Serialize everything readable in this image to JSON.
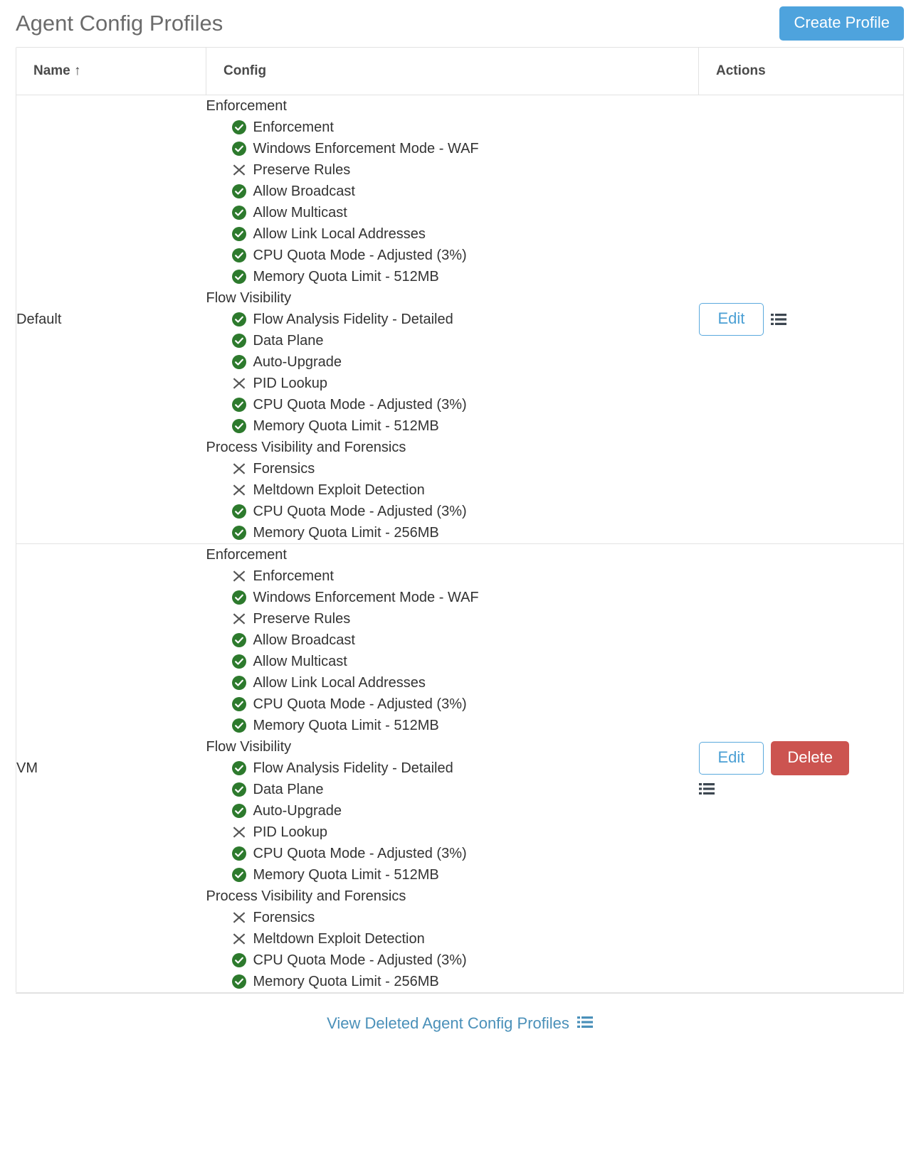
{
  "header": {
    "title": "Agent Config Profiles",
    "create_button": "Create Profile",
    "create_button_color": "#4ea3dd"
  },
  "table": {
    "columns": [
      {
        "label": "Name ↑",
        "key": "name"
      },
      {
        "label": "Config",
        "key": "config"
      },
      {
        "label": "Actions",
        "key": "actions"
      }
    ],
    "sort": {
      "column": "Name",
      "direction": "asc",
      "indicator": "↑"
    },
    "rows": [
      {
        "name": "Default",
        "config_groups": [
          {
            "title": "Enforcement",
            "items": [
              {
                "label": "Enforcement",
                "status": "enabled"
              },
              {
                "label": "Windows Enforcement Mode - WAF",
                "status": "enabled"
              },
              {
                "label": "Preserve Rules",
                "status": "disabled"
              },
              {
                "label": "Allow Broadcast",
                "status": "enabled"
              },
              {
                "label": "Allow Multicast",
                "status": "enabled"
              },
              {
                "label": "Allow Link Local Addresses",
                "status": "enabled"
              },
              {
                "label": "CPU Quota Mode - Adjusted (3%)",
                "status": "enabled"
              },
              {
                "label": "Memory Quota Limit - 512MB",
                "status": "enabled"
              }
            ]
          },
          {
            "title": "Flow Visibility",
            "items": [
              {
                "label": "Flow Analysis Fidelity - Detailed",
                "status": "enabled"
              },
              {
                "label": "Data Plane",
                "status": "enabled"
              },
              {
                "label": "Auto-Upgrade",
                "status": "enabled"
              },
              {
                "label": "PID Lookup",
                "status": "disabled"
              },
              {
                "label": "CPU Quota Mode - Adjusted (3%)",
                "status": "enabled"
              },
              {
                "label": "Memory Quota Limit - 512MB",
                "status": "enabled"
              }
            ]
          },
          {
            "title": "Process Visibility and Forensics",
            "items": [
              {
                "label": "Forensics",
                "status": "disabled"
              },
              {
                "label": "Meltdown Exploit Detection",
                "status": "disabled"
              },
              {
                "label": "CPU Quota Mode - Adjusted (3%)",
                "status": "enabled"
              },
              {
                "label": "Memory Quota Limit - 256MB",
                "status": "enabled"
              }
            ]
          }
        ],
        "actions": {
          "edit_label": "Edit",
          "delete_label": null,
          "has_delete": false,
          "list_icon": "list-icon"
        }
      },
      {
        "name": "VM",
        "config_groups": [
          {
            "title": "Enforcement",
            "items": [
              {
                "label": "Enforcement",
                "status": "disabled"
              },
              {
                "label": "Windows Enforcement Mode - WAF",
                "status": "enabled"
              },
              {
                "label": "Preserve Rules",
                "status": "disabled"
              },
              {
                "label": "Allow Broadcast",
                "status": "enabled"
              },
              {
                "label": "Allow Multicast",
                "status": "enabled"
              },
              {
                "label": "Allow Link Local Addresses",
                "status": "enabled"
              },
              {
                "label": "CPU Quota Mode - Adjusted (3%)",
                "status": "enabled"
              },
              {
                "label": "Memory Quota Limit - 512MB",
                "status": "enabled"
              }
            ]
          },
          {
            "title": "Flow Visibility",
            "items": [
              {
                "label": "Flow Analysis Fidelity - Detailed",
                "status": "enabled"
              },
              {
                "label": "Data Plane",
                "status": "enabled"
              },
              {
                "label": "Auto-Upgrade",
                "status": "enabled"
              },
              {
                "label": "PID Lookup",
                "status": "disabled"
              },
              {
                "label": "CPU Quota Mode - Adjusted (3%)",
                "status": "enabled"
              },
              {
                "label": "Memory Quota Limit - 512MB",
                "status": "enabled"
              }
            ]
          },
          {
            "title": "Process Visibility and Forensics",
            "items": [
              {
                "label": "Forensics",
                "status": "disabled"
              },
              {
                "label": "Meltdown Exploit Detection",
                "status": "disabled"
              },
              {
                "label": "CPU Quota Mode - Adjusted (3%)",
                "status": "enabled"
              },
              {
                "label": "Memory Quota Limit - 256MB",
                "status": "enabled"
              }
            ]
          }
        ],
        "actions": {
          "edit_label": "Edit",
          "delete_label": "Delete",
          "has_delete": true,
          "list_icon": "list-icon"
        }
      }
    ]
  },
  "footer": {
    "link_label": "View Deleted Agent Config Profiles",
    "link_icon": "list-icon",
    "link_color": "#4a90b9"
  },
  "colors": {
    "enabled_green": "#2d7a2d",
    "disabled_gray": "#555555",
    "primary_blue": "#4ea3dd",
    "danger_red": "#cc5450",
    "border": "#e2e2e2"
  }
}
